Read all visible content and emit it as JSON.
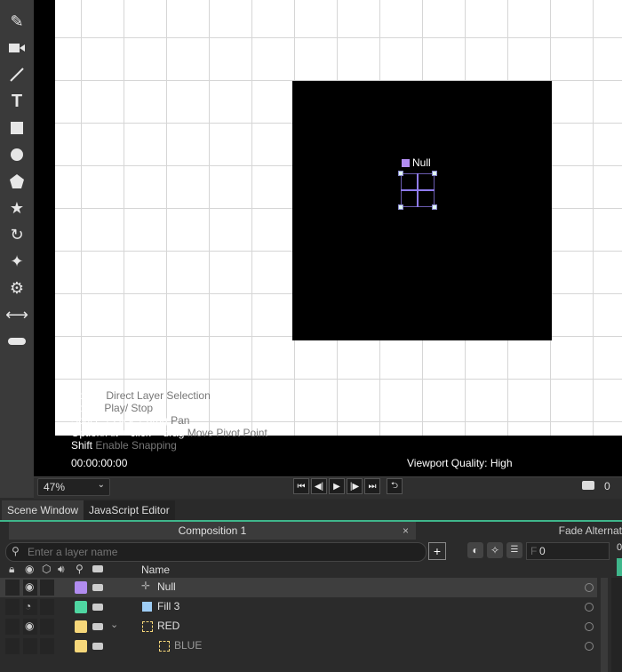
{
  "viewport": {
    "null_label": "Null",
    "hints": [
      {
        "key": "Hold S",
        "action": "Direct Layer Selection"
      },
      {
        "key": "Space",
        "action": "Play/ Stop"
      },
      {
        "key": "Space + click + drag",
        "action": "Pan"
      },
      {
        "key": "Option/Alt + click + drag",
        "action": "Move Pivot Point"
      },
      {
        "key": "Shift",
        "action": "Enable Snapping"
      }
    ],
    "timecode": "00:00:00:00",
    "quality": "Viewport Quality: High"
  },
  "timebar": {
    "zoom": "47%",
    "counter": "0"
  },
  "tabs": {
    "scene": "Scene Window",
    "js": "JavaScript Editor"
  },
  "composition": {
    "title": "Composition 1",
    "close": "×",
    "right_title": "Fade Alternat",
    "search_placeholder": "Enter a layer name",
    "frame_label": "F",
    "frame_value": "0",
    "name_header": "Name",
    "right_tick": "0"
  },
  "layers": [
    {
      "name": "Null",
      "color": "#b18cf0",
      "icon": "null-icon",
      "selected": true
    },
    {
      "name": "Fill 3",
      "color": "#4fd6a2",
      "icon": "fill-icon",
      "selected": false
    },
    {
      "name": "RED",
      "color": "#f6d77a",
      "icon": "group-icon",
      "selected": false
    },
    {
      "name": "BLUE",
      "color": "#f6d77a",
      "icon": "group-icon",
      "selected": false
    }
  ],
  "colors": {
    "accent": "#3fb68b",
    "null_purple": "#b18cf0"
  }
}
